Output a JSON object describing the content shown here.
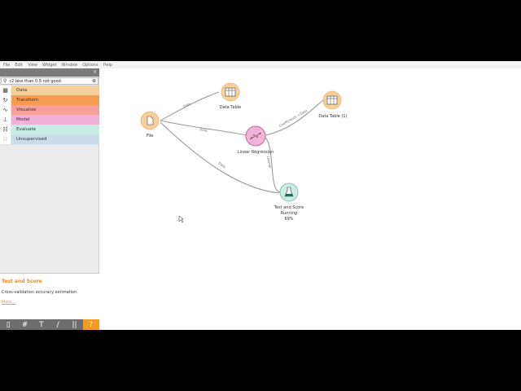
{
  "menubar": {
    "items": [
      "File",
      "Edit",
      "View",
      "Widget",
      "Window",
      "Options",
      "Help"
    ]
  },
  "sidebar": {
    "search": {
      "value": "r2 less than 0.5 not good"
    },
    "categories": [
      {
        "label": "Data",
        "color": "#f7cf9a",
        "icon": "table-icon"
      },
      {
        "label": "Transform",
        "color": "#f79a52",
        "icon": "transform-icon"
      },
      {
        "label": "Visualize",
        "color": "#f5a09a",
        "icon": "chart-icon"
      },
      {
        "label": "Model",
        "color": "#f2b1d6",
        "icon": "model-icon"
      },
      {
        "label": "Evaluate",
        "color": "#c7ede5",
        "icon": "evaluate-icon"
      },
      {
        "label": "Unsupervised",
        "color": "#cbdced",
        "icon": "unsupervised-icon"
      }
    ]
  },
  "help": {
    "title": "Test and Score",
    "description": "Cross-validation accuracy estimation.",
    "more": "More..."
  },
  "toolbar": {
    "buttons": [
      "▯",
      "#",
      "T",
      "∕",
      "||",
      "?"
    ]
  },
  "canvas": {
    "nodes": {
      "file": {
        "label": "File",
        "color": "#f7cf9a"
      },
      "data_table": {
        "label": "Data Table",
        "color": "#f7cf9a"
      },
      "data_table_1": {
        "label": "Data Table (1)",
        "color": "#f7cf9a"
      },
      "linear_regression": {
        "label": "Linear Regression",
        "color": "#f2b1d6"
      },
      "test_and_score": {
        "label": "Test and Score",
        "status": "Running",
        "progress": "69%",
        "color": "#c7ede5"
      }
    },
    "links": {
      "file_datatable": "Data",
      "file_linreg": "Data",
      "file_testscore": "Data",
      "linreg_datatable1": "Coefficients → Data",
      "linreg_testscore": "Learner"
    }
  }
}
